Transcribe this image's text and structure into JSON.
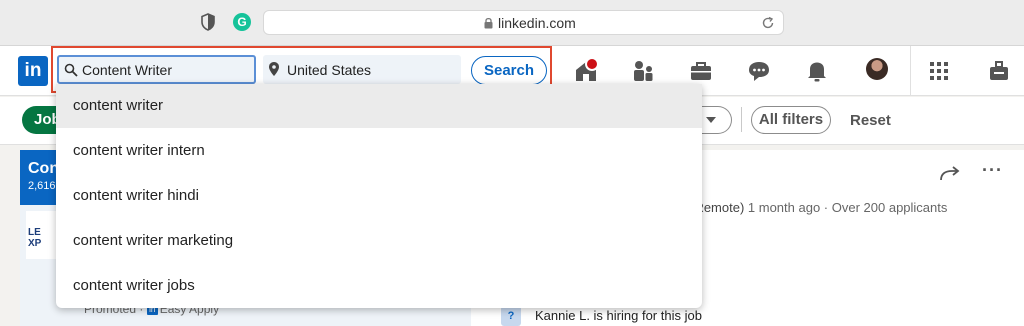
{
  "browser": {
    "url": "linkedin.com",
    "extension_badge": "G"
  },
  "header": {
    "logo_text": "in",
    "keyword": "Content Writer",
    "location": "United States",
    "search_label": "Search"
  },
  "filters": {
    "jobs_label": "Jobs",
    "all_filters_label": "All filters",
    "reset_label": "Reset"
  },
  "left": {
    "title": "Cont",
    "subtitle": "2,616",
    "company_logo_text": "LE\nXP",
    "promoted_text": "Promoted · ",
    "easy_apply": "Easy Apply"
  },
  "right": {
    "meta_remote": "s (Remote)",
    "meta_time": " 1 month ago · ",
    "meta_applicants": "Over 200 applicants",
    "hiring_text": "Kannie L. is hiring for this job",
    "more_label": "···"
  },
  "suggestions": [
    "content writer",
    "content writer intern",
    "content writer hindi",
    "content writer marketing",
    "content writer jobs"
  ],
  "colors": {
    "brand": "#0a66c2",
    "jobs_green": "#057642",
    "highlight_box": "#e0482f"
  }
}
